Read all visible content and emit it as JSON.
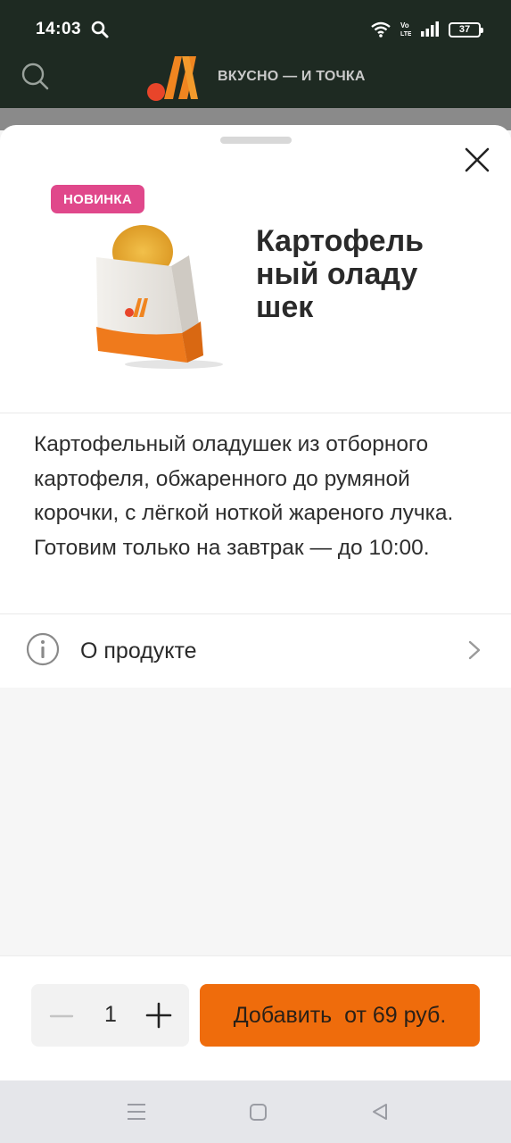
{
  "status_bar": {
    "time": "14:03",
    "battery": "37",
    "icons": [
      "search-icon",
      "wifi-icon",
      "volte-icon",
      "signal-icon",
      "battery-icon"
    ]
  },
  "header": {
    "brand_text": "ВКУСНО — И ТОЧКА",
    "icons": [
      "search-icon",
      "logo"
    ]
  },
  "product": {
    "badge": "НОВИНКА",
    "title": "Картофельный оладушек",
    "description": "Картофельный оладушек из отборного картофеля, обжаренного до румяной корочки, с лёгкой ноткой жареного лучка.",
    "schedule_note": "Готовим только на завтрак — до 10:00.",
    "about_label": "О продукте"
  },
  "order": {
    "quantity": "1",
    "add_button": "Добавить  от 69 руб."
  },
  "colors": {
    "header_bg": "#1e2a22",
    "badge": "#e0488b",
    "accent": "#ef6c0c",
    "logo_red": "#e8452a"
  }
}
